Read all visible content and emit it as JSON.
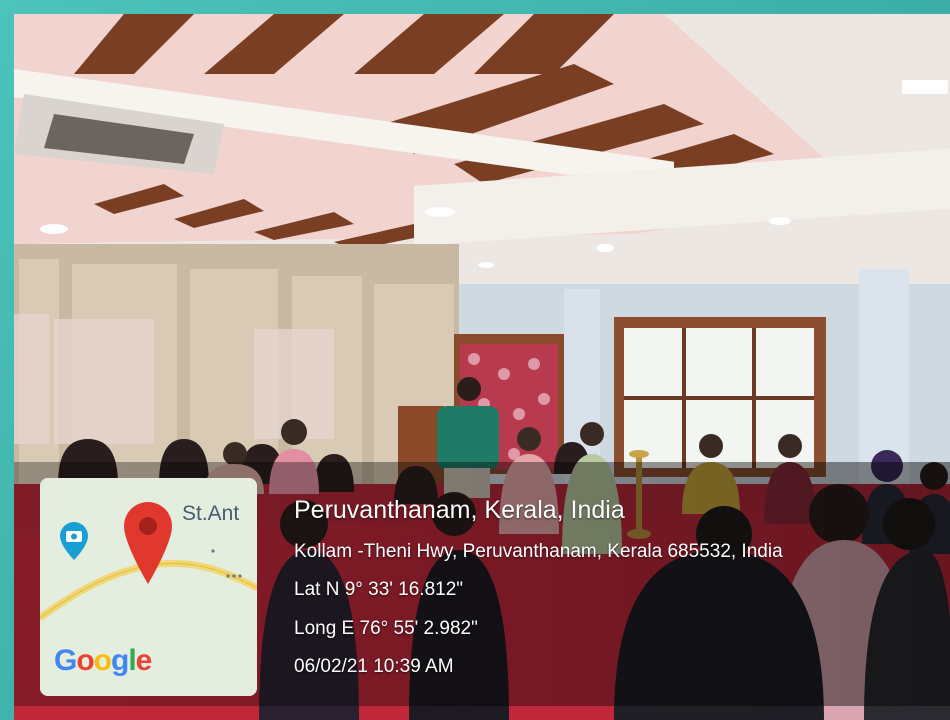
{
  "geotag": {
    "place": "Peruvanthanam, Kerala, India",
    "address": "Kollam -Theni Hwy, Peruvanthanam, Kerala 685532, India",
    "latitude": "Lat N 9° 33' 16.812\"",
    "longitude": "Long E 76° 55' 2.982\"",
    "datetime": "06/02/21 10:39 AM"
  },
  "map": {
    "place_label": "St.Ant",
    "brand": [
      "G",
      "o",
      "o",
      "g",
      "l",
      "e"
    ],
    "pin_color": "#e0382d",
    "camera_marker_color": "#1a9ed6"
  },
  "colors": {
    "frame": "#3fb8b0",
    "carpet": "#c0283a",
    "wall": "#cfd9e2",
    "ceiling_beam": "#7a3e22"
  },
  "scene": {
    "icon_names": [
      "ceiling-ac-icon",
      "downlight-icon",
      "chair-icon",
      "window-icon",
      "podium-icon",
      "oil-lamp-icon",
      "person-icon"
    ]
  }
}
